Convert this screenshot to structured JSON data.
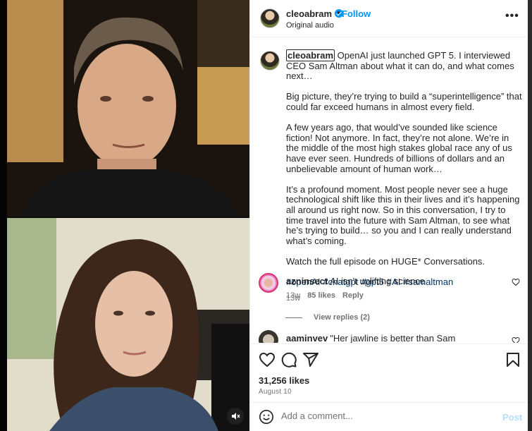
{
  "post": {
    "username": "cleoabram",
    "follow_label": "Follow",
    "dot": "•",
    "audio": "Original audio",
    "more_label": "•••"
  },
  "caption": {
    "username": "cleoabram",
    "paragraphs": [
      "OpenAI just launched GPT 5. I interviewed CEO Sam Altman about what it can do, and what comes next…",
      "Big picture, they’re trying to build a “superintelligence” that could far exceed humans in almost every field.",
      "A few years ago, that would’ve sounded like science fiction! Not anymore. In fact, they’re not alone. We’re in the middle of the most high stakes global race any of us have ever seen. Hundreds of billions of dollars and an unbelievable amount of human work…",
      "It’s a profound moment. Most people never see a huge technological shift like this in their lives and it’s happening all around us right now. So in this conversation, I try to time travel into the future with Sam Altman, to see what he’s trying to build… so you and I can really understand what’s coming.",
      "Watch the full episode on HUGE* Conversations."
    ],
    "hashtags": [
      "#openAI",
      "#chatgpt",
      "#gpt5",
      "#AI",
      "#samaltman"
    ],
    "time": "13w"
  },
  "comments": [
    {
      "username": "azninsect",
      "text": "AI isn't uplifting science",
      "time": "13w",
      "likes": "85 likes",
      "reply": "Reply",
      "view_replies": "View replies (2)"
    },
    {
      "username": "aaminvev",
      "text": "\"Her jawline is better than Sam Altman’s.\"😂"
    }
  ],
  "actions": {
    "likes": "31,256 likes",
    "date": "August 10"
  },
  "add_comment": {
    "placeholder": "Add a comment...",
    "post_label": "Post"
  },
  "colors": {
    "accent": "#0095f6",
    "post_disabled": "#b2dffc",
    "muted_text": "#737373",
    "hashtag": "#00376b"
  },
  "icons": [
    "verified-badge-icon",
    "more-options-icon",
    "heart-icon",
    "comment-icon",
    "share-icon",
    "save-icon",
    "emoji-icon",
    "mute-icon"
  ]
}
